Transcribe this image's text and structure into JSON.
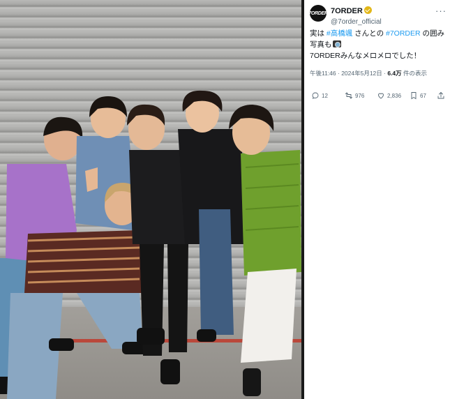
{
  "tweet": {
    "display_name": "7ORDER",
    "handle": "@7order_official",
    "avatar_text": "7ORDER",
    "more_label": "···",
    "text": {
      "part1": "実は ",
      "hashtag1": "#高橋颯",
      "part2": " さんとの ",
      "hashtag2": "#7ORDER",
      "part3": " の囲み写真も",
      "line2": "7ORDERみんなメロメロでした！"
    },
    "timestamp": "午後11:46 · 2024年5月12日 · ",
    "views_count": "6.4万",
    "views_label": " 件の表示",
    "actions": {
      "replies": "12",
      "retweets": "976",
      "likes": "2,836",
      "bookmarks": "67"
    }
  },
  "colors": {
    "hashtag": "#1d9bf0",
    "verified": "#e2b719",
    "secondary_text": "#536471"
  },
  "icons": {
    "reply": "reply-icon",
    "retweet": "retweet-icon",
    "like": "heart-icon",
    "bookmark": "bookmark-icon",
    "share": "share-icon",
    "verified": "verified-badge-icon"
  }
}
